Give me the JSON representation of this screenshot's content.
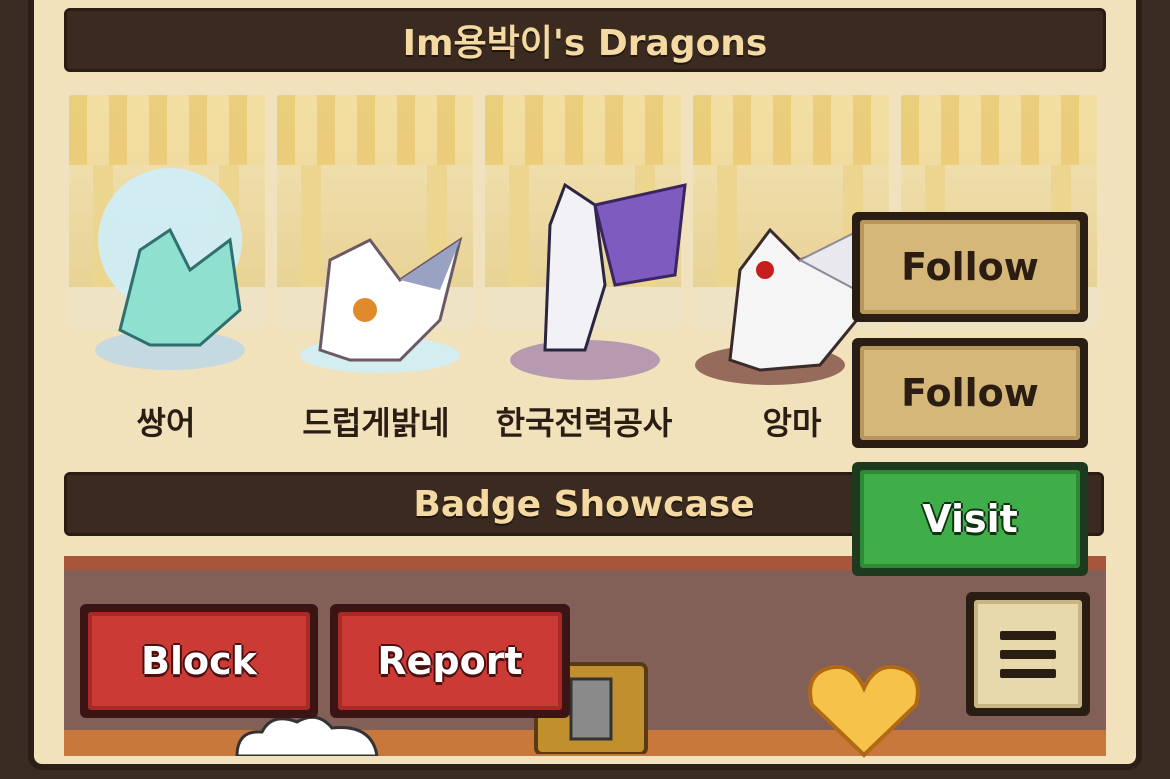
{
  "dragons_section": {
    "title": "Im용박이's Dragons",
    "dragons": [
      {
        "name": "쌍어"
      },
      {
        "name": "드럽게밝네"
      },
      {
        "name": "한국전력공사"
      },
      {
        "name": "앙마"
      }
    ]
  },
  "badge_section": {
    "title": "Badge Showcase"
  },
  "actions": {
    "follow_1": "Follow",
    "follow_2": "Follow",
    "visit": "Visit",
    "block": "Block",
    "report": "Report"
  },
  "colors": {
    "panel": "#f2e2bc",
    "header": "#3b2a1f",
    "follow": "#d6b77a",
    "visit": "#3fae48",
    "red": "#cc3a36"
  }
}
